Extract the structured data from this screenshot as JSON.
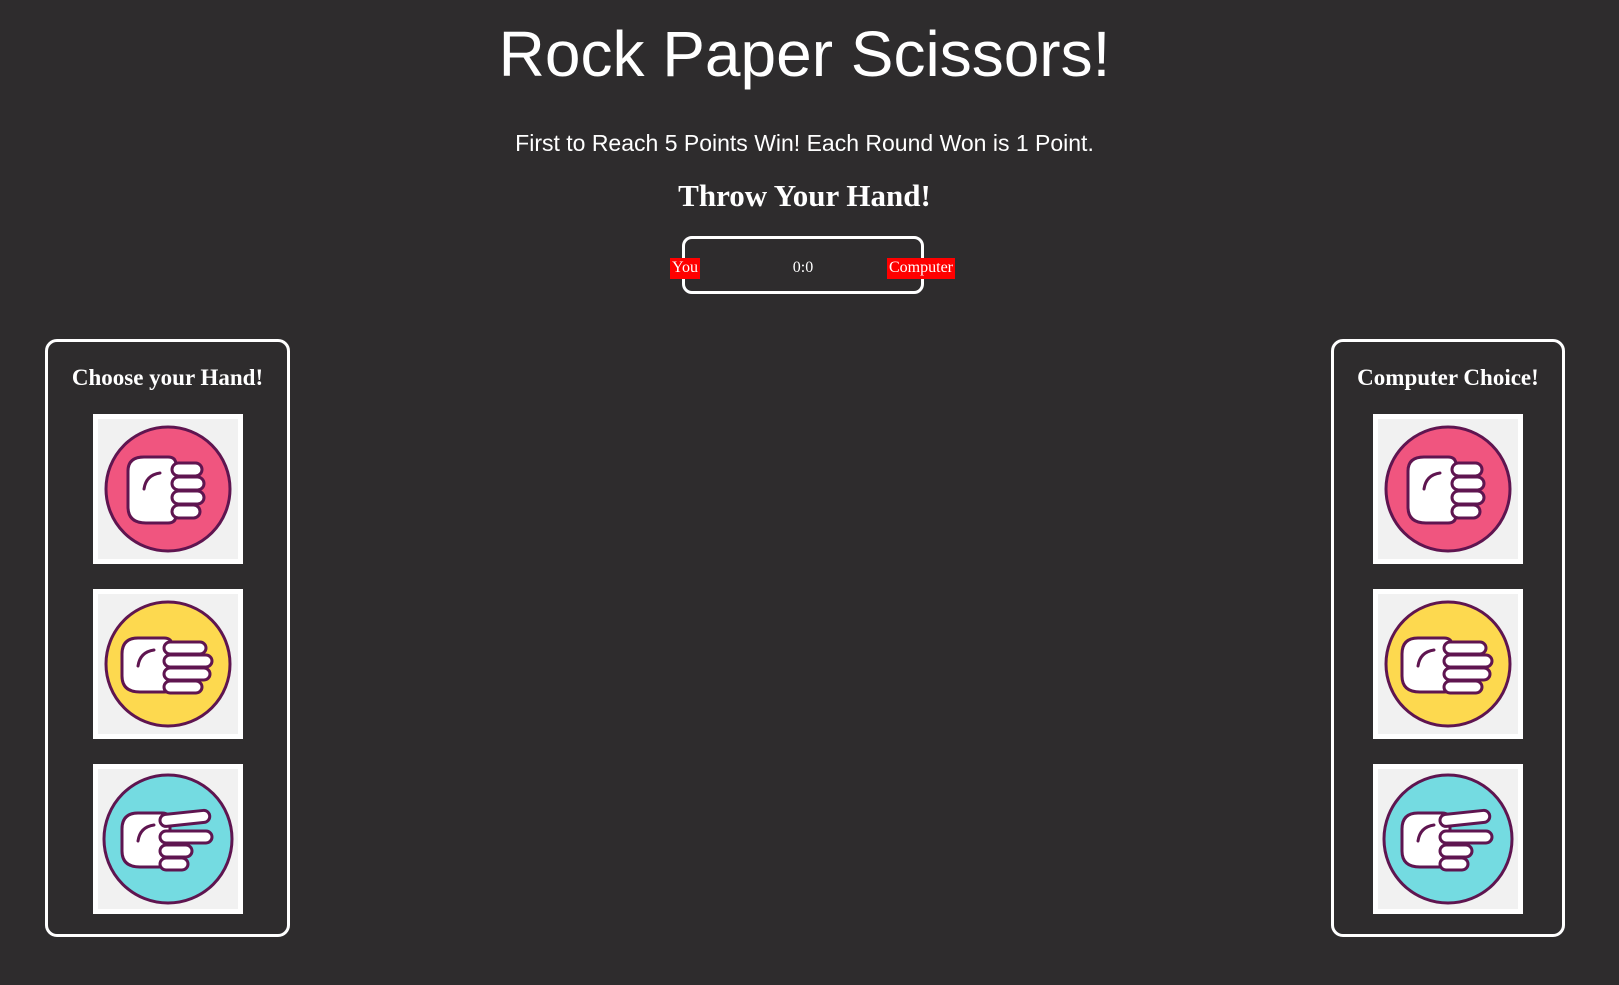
{
  "header": {
    "title": "Rock Paper Scissors!",
    "subtitle": "First to Reach 5 Points Win! Each Round Won is 1 Point.",
    "throw_heading": "Throw Your Hand!"
  },
  "scoreboard": {
    "player_label": "You",
    "score": "0:0",
    "computer_label": "Computer"
  },
  "player_panel": {
    "title": "Choose your Hand!",
    "hands": [
      {
        "icon": "rock-icon",
        "color": "#f0557f"
      },
      {
        "icon": "paper-icon",
        "color": "#fdd94f"
      },
      {
        "icon": "scissors-icon",
        "color": "#74dbe1"
      }
    ]
  },
  "computer_panel": {
    "title": "Computer Choice!",
    "hands": [
      {
        "icon": "rock-icon",
        "color": "#f0557f"
      },
      {
        "icon": "paper-icon",
        "color": "#fdd94f"
      },
      {
        "icon": "scissors-icon",
        "color": "#74dbe1"
      }
    ]
  },
  "colors": {
    "background": "#2e2c2d",
    "badge": "#ff0000",
    "icon_outline": "#5f1550",
    "card_background": "#f1f1f1"
  }
}
